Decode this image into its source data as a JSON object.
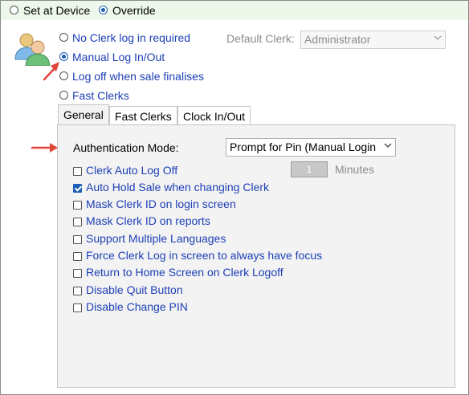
{
  "clerk_mode": {
    "options": [
      {
        "label": "Set at Device",
        "selected": false
      },
      {
        "label": "Override",
        "selected": true
      }
    ]
  },
  "login_options": [
    {
      "label": "No Clerk log in required",
      "selected": false
    },
    {
      "label": "Manual Log In/Out",
      "selected": true
    },
    {
      "label": "Log off when sale finalises",
      "selected": false
    },
    {
      "label": "Fast Clerks",
      "selected": false
    }
  ],
  "default_clerk": {
    "label": "Default Clerk:",
    "value": "Administrator"
  },
  "tabs": [
    {
      "label": "General",
      "active": true
    },
    {
      "label": "Fast Clerks",
      "active": false
    },
    {
      "label": "Clock In/Out",
      "active": false
    }
  ],
  "general": {
    "auth_mode_label": "Authentication Mode:",
    "auth_mode_value": "Prompt for Pin (Manual Login",
    "auto_logoff_value": "1",
    "minutes_label": "Minutes",
    "checkboxes": [
      {
        "label": "Clerk Auto Log Off",
        "checked": false
      },
      {
        "label": "Auto Hold Sale when changing Clerk",
        "checked": true
      },
      {
        "label": "Mask Clerk ID on login screen",
        "checked": false
      },
      {
        "label": "Mask Clerk ID on reports",
        "checked": false
      },
      {
        "label": "Support Multiple Languages",
        "checked": false
      },
      {
        "label": "Force Clerk Log in screen to always have focus",
        "checked": false
      },
      {
        "label": "Return to Home Screen on Clerk Logoff",
        "checked": false
      },
      {
        "label": "Disable Quit Button",
        "checked": false
      },
      {
        "label": "Disable Change PIN",
        "checked": false
      }
    ]
  },
  "colors": {
    "accent": "#1a5fb4",
    "link_text": "#1d3fb5",
    "annotation_arrow": "#e0453a",
    "top_bar_bg": "#eef8ea",
    "panel_bg": "#f3f3f3"
  },
  "icons": {
    "users": "users-icon",
    "arrow": "red-annotation-arrow"
  }
}
